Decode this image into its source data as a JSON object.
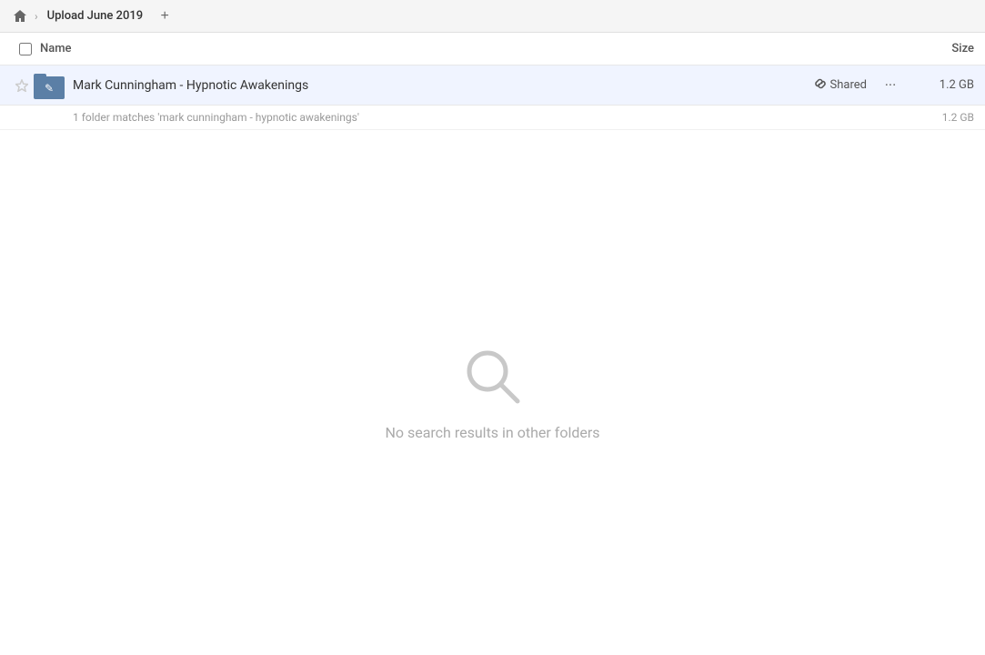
{
  "topbar": {
    "home_icon": "home",
    "chevron": "›",
    "breadcrumb_label": "Upload June 2019",
    "add_tab_label": "+"
  },
  "columns": {
    "name_label": "Name",
    "size_label": "Size"
  },
  "file_row": {
    "folder_name": "Mark Cunningham - Hypnotic Awakenings",
    "shared_label": "Shared",
    "size": "1.2 GB",
    "more_label": "···"
  },
  "match_info": {
    "text": "1 folder matches 'mark cunningham - hypnotic awakenings'",
    "size": "1.2 GB"
  },
  "empty_state": {
    "message": "No search results in other folders"
  }
}
